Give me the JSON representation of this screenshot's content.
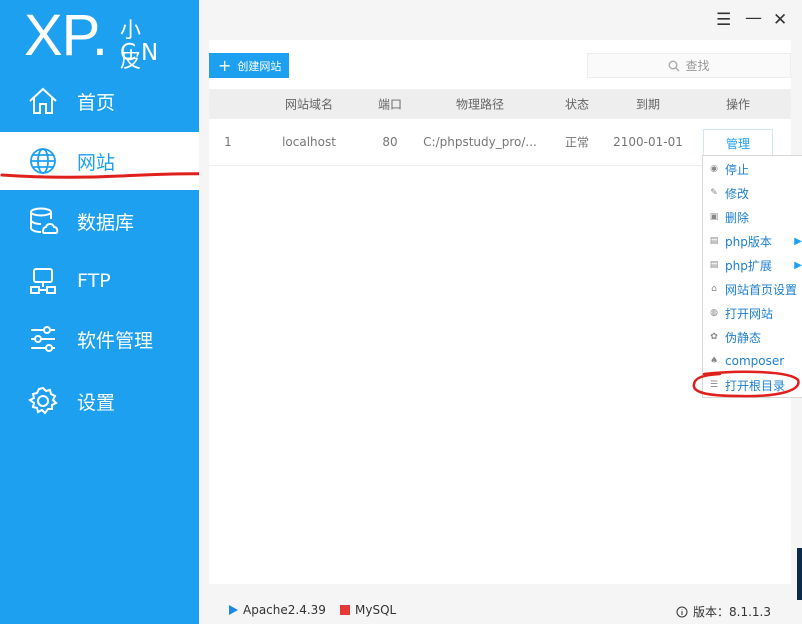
{
  "logo": {
    "main": "XP",
    "dot": ".",
    "zh": "小皮",
    "en": "CN"
  },
  "sidebar": {
    "items": [
      {
        "label": "首页",
        "icon": "home-icon"
      },
      {
        "label": "网站",
        "icon": "globe-icon",
        "active": true
      },
      {
        "label": "数据库",
        "icon": "database-icon"
      },
      {
        "label": "FTP",
        "icon": "ftp-icon"
      },
      {
        "label": "软件管理",
        "icon": "sliders-icon"
      },
      {
        "label": "设置",
        "icon": "gear-icon"
      }
    ]
  },
  "window": {
    "menu": "☰",
    "minimize": "—",
    "close": "✕"
  },
  "toolbar": {
    "create_plus": "+",
    "create_label": "创建网站",
    "search_placeholder": "查找"
  },
  "table": {
    "headers": [
      "网站域名",
      "端口",
      "物理路径",
      "状态",
      "到期",
      "操作"
    ],
    "rows": [
      {
        "index": "1",
        "domain": "localhost",
        "port": "80",
        "path": "C:/phpstudy_pro/...",
        "status": "正常",
        "expire": "2100-01-01",
        "action": "管理"
      }
    ]
  },
  "context_menu": {
    "items": [
      {
        "label": "停止",
        "icon": "stop-icon"
      },
      {
        "label": "修改",
        "icon": "edit-icon"
      },
      {
        "label": "删除",
        "icon": "trash-icon"
      },
      {
        "label": "php版本",
        "icon": "php-icon",
        "submenu": true
      },
      {
        "label": "php扩展",
        "icon": "extension-icon",
        "submenu": true
      },
      {
        "label": "网站首页设置",
        "icon": "homepage-icon"
      },
      {
        "label": "打开网站",
        "icon": "browser-icon"
      },
      {
        "label": "伪静态",
        "icon": "rewrite-icon"
      },
      {
        "label": "composer",
        "icon": "composer-icon"
      },
      {
        "label": "打开根目录",
        "icon": "list-icon"
      }
    ]
  },
  "statusbar": {
    "apache": "Apache2.4.39",
    "mysql": "MySQL",
    "version": "版本：8.1.1.3"
  },
  "colors": {
    "brand": "#1ea0f0",
    "apache": "#1e88e5",
    "mysql": "#e53935",
    "annotation": "#e0201c"
  }
}
